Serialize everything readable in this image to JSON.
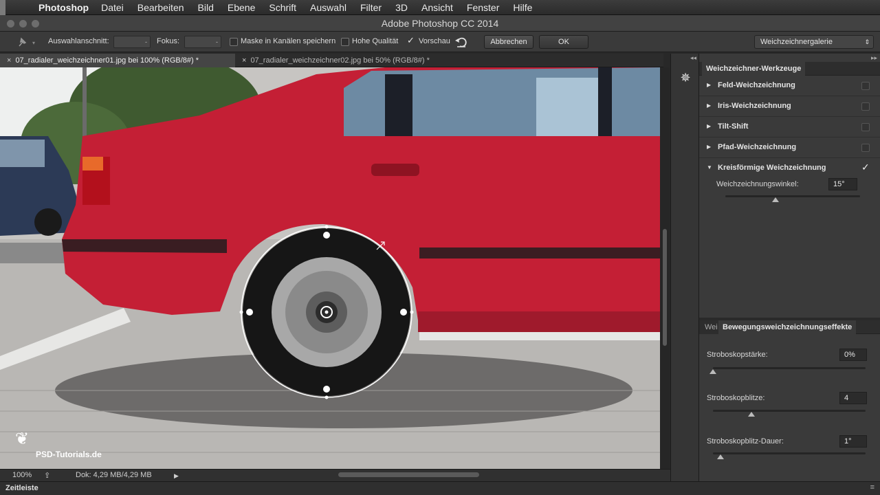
{
  "menubar": {
    "app_name": "Photoshop",
    "items": [
      "Datei",
      "Bearbeiten",
      "Bild",
      "Ebene",
      "Schrift",
      "Auswahl",
      "Filter",
      "3D",
      "Ansicht",
      "Fenster",
      "Hilfe"
    ]
  },
  "window": {
    "title": "Adobe Photoshop CC 2014"
  },
  "options": {
    "selection_label": "Auswahlanschnitt:",
    "focus_label": "Fokus:",
    "mask_label": "Maske in Kanälen speichern",
    "quality_label": "Hohe Qualität",
    "preview_label": "Vorschau",
    "preview_checked": true,
    "cancel_label": "Abbrechen",
    "ok_label": "OK",
    "gallery_label": "Weichzeichnergalerie"
  },
  "tabs": [
    {
      "label": "07_radialer_weichzeichner01.jpg bei 100% (RGB/8#) *",
      "active": true
    },
    {
      "label": "07_radialer_weichzeichner02.jpg bei 50% (RGB/8#) *",
      "active": false
    }
  ],
  "watermark": {
    "text": "PSD-Tutorials.de"
  },
  "status": {
    "zoom": "100%",
    "doc_size": "Dok: 4,29 MB/4,29 MB"
  },
  "timeline": {
    "label": "Zeitleiste"
  },
  "blur_tools": {
    "tab_label": "Weichzeichner-Werkzeuge",
    "items": [
      {
        "name": "Feld-Weichzeichnung",
        "expanded": false,
        "checked": false
      },
      {
        "name": "Iris-Weichzeichnung",
        "expanded": false,
        "checked": false
      },
      {
        "name": "Tilt-Shift",
        "expanded": false,
        "checked": false
      },
      {
        "name": "Pfad-Weichzeichnung",
        "expanded": false,
        "checked": false
      },
      {
        "name": "Kreisförmige Weichzeichnung",
        "expanded": true,
        "checked": true
      }
    ],
    "angle_label": "Weichzeichnungswinkel:",
    "angle_value": "15°",
    "angle_fraction": 0.37
  },
  "motion_effects": {
    "tab_dim_label": "Wei",
    "tab_label": "Bewegungsweichzeichnungseffekte",
    "params": [
      {
        "label": "Stroboskopstärke:",
        "value": "0%",
        "fraction": 0.0
      },
      {
        "label": "Stroboskopblitze:",
        "value": "4",
        "fraction": 0.25
      },
      {
        "label": "Stroboskopblitz-Dauer:",
        "value": "1°",
        "fraction": 0.05
      }
    ]
  },
  "colors": {
    "car_red": "#c41f35",
    "panel_bg": "#3a3a3a",
    "menubar_bg": "#2f2f2f"
  }
}
